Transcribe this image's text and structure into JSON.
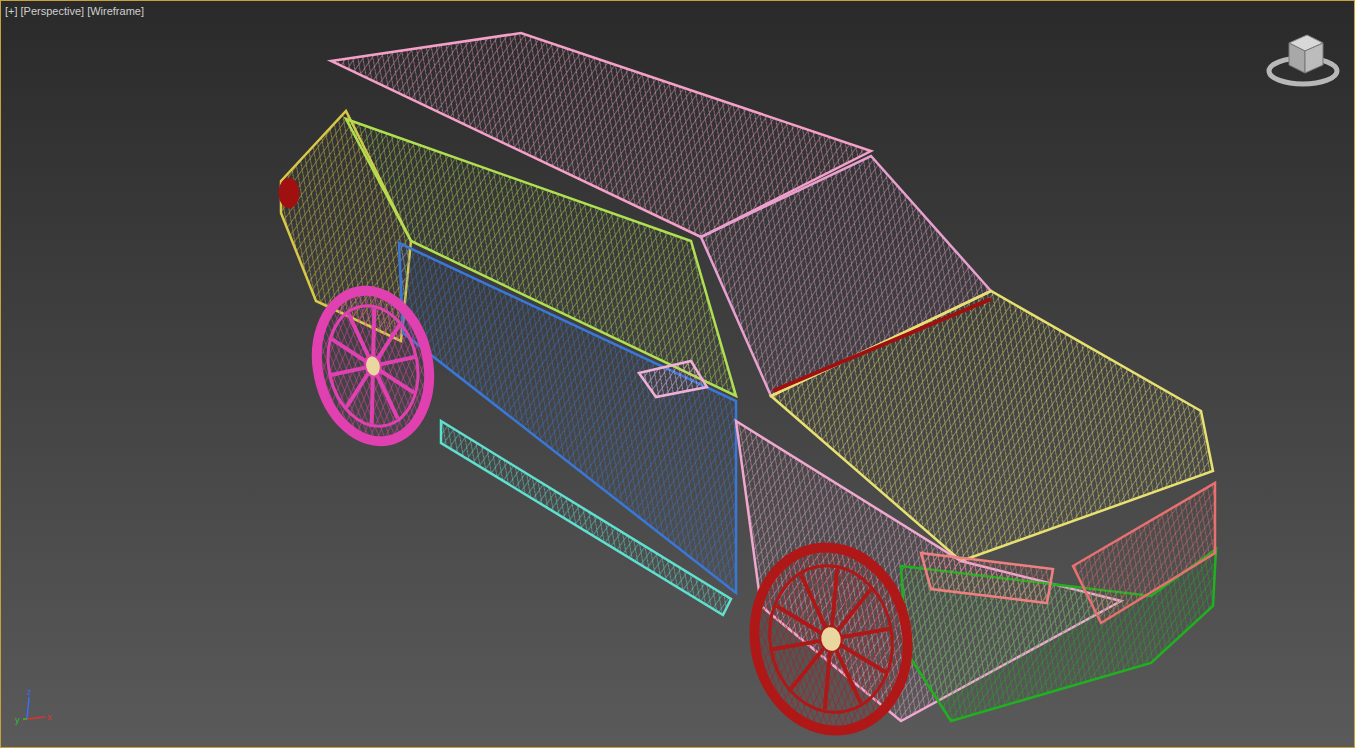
{
  "viewport": {
    "active": true,
    "labels": [
      {
        "text": "[+]"
      },
      {
        "text": "[Perspective]"
      },
      {
        "text": "[Wireframe]"
      }
    ]
  },
  "axis": {
    "labels": [
      "z",
      "x",
      "y"
    ]
  },
  "objects": [
    {
      "kind": "panel",
      "color": "#d8c848"
    },
    {
      "kind": "panel",
      "color": "#f4a0c8"
    },
    {
      "kind": "panel",
      "color": "#b0e050"
    },
    {
      "kind": "panel",
      "color": "#3a78d8"
    },
    {
      "kind": "panel",
      "color": "#e8a0d0"
    },
    {
      "kind": "panel",
      "color": "#e8e070"
    },
    {
      "kind": "panel",
      "color": "#f0a8d0"
    },
    {
      "kind": "panel",
      "color": "#60e0d0"
    },
    {
      "kind": "panel",
      "color": "#20b020"
    },
    {
      "kind": "panel",
      "color": "#e87070"
    },
    {
      "kind": "panel",
      "color": "#f08080"
    },
    {
      "kind": "panel",
      "color": "#f0b0d8"
    },
    {
      "kind": "wheel",
      "color": "#e040b0"
    },
    {
      "kind": "wheel",
      "color": "#b01818"
    },
    {
      "kind": "light",
      "color": "#a01010"
    }
  ]
}
